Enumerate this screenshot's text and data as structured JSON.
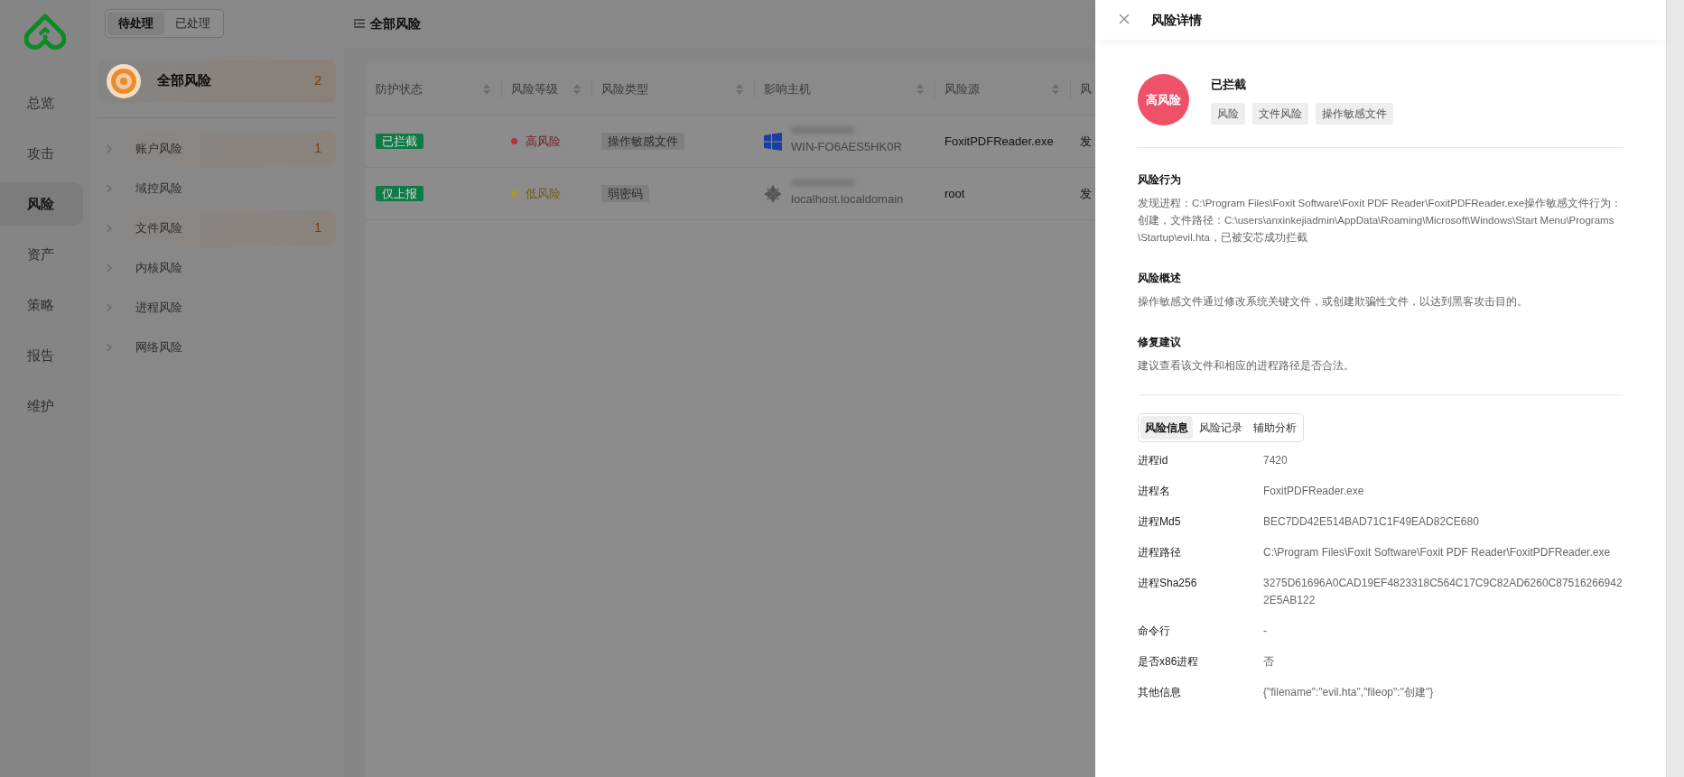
{
  "nav": [
    {
      "label": "总览",
      "selected": false
    },
    {
      "label": "攻击",
      "selected": false
    },
    {
      "label": "风险",
      "selected": true
    },
    {
      "label": "资产",
      "selected": false
    },
    {
      "label": "策略",
      "selected": false
    },
    {
      "label": "报告",
      "selected": false
    },
    {
      "label": "维护",
      "selected": false
    }
  ],
  "status_tabs": [
    {
      "label": "待处理",
      "selected": true
    },
    {
      "label": "已处理",
      "selected": false
    }
  ],
  "all_risks": {
    "label": "全部风险",
    "count": "2",
    "selected": true
  },
  "categories": [
    {
      "label": "账户风险",
      "count": "1"
    },
    {
      "label": "域控风险"
    },
    {
      "label": "文件风险",
      "count": "1"
    },
    {
      "label": "内核风险"
    },
    {
      "label": "进程风险"
    },
    {
      "label": "网络风险"
    }
  ],
  "main": {
    "title": "全部风险"
  },
  "table": {
    "columns": [
      {
        "label": "防护状态",
        "sortable": true
      },
      {
        "label": "风险等级",
        "sortable": true
      },
      {
        "label": "风险类型",
        "sortable": true
      },
      {
        "label": "影响主机",
        "sortable": true
      },
      {
        "label": "风险源",
        "sortable": true
      },
      {
        "label": "风",
        "sortable": false
      }
    ],
    "rows": [
      {
        "protection": "已拦截",
        "level": {
          "text": "高风险",
          "color": "#b8313f"
        },
        "type": "操作敏感文件",
        "host": {
          "kind": "windows",
          "name": "WIN-FO6AES5HK0R"
        },
        "source": "FoxitPDFReader.exe",
        "column_6": "发"
      },
      {
        "protection": "仅上报",
        "level": {
          "text": "低风险",
          "color": "#b0932e"
        },
        "type": "弱密码",
        "host": {
          "kind": "linux",
          "name": "localhost.localdomain"
        },
        "source": "root",
        "column_6": "发"
      }
    ]
  },
  "drawer": {
    "title": "风险详情",
    "level_badge": {
      "text": "高风险",
      "color": "#ef5169"
    },
    "status": "已拦截",
    "tags": [
      "风险",
      "文件风险",
      "操作敏感文件"
    ],
    "sections": [
      {
        "heading": "风险行为",
        "text": "发现进程：C:\\Program Files\\Foxit Software\\Foxit PDF Reader\\FoxitPDFReader.exe操作敏感文件行为：创建，文件路径：C:\\users\\anxinkejiadmin\\AppData\\Roaming\\Microsoft\\Windows\\Start Menu\\Programs\\Startup\\evil.hta，已被安芯成功拦截"
      },
      {
        "heading": "风险概述",
        "text": "操作敏感文件通过修改系统关键文件，或创建欺骗性文件，以达到黑客攻击目的。"
      },
      {
        "heading": "修复建议",
        "text": "建议查看该文件和相应的进程路径是否合法。"
      }
    ],
    "tabs": [
      {
        "label": "风险信息",
        "selected": true
      },
      {
        "label": "风险记录",
        "selected": false
      },
      {
        "label": "辅助分析",
        "selected": false
      }
    ],
    "fields": [
      {
        "label": "进程id",
        "value": "7420"
      },
      {
        "label": "进程名",
        "value": "FoxitPDFReader.exe"
      },
      {
        "label": "进程Md5",
        "value": "BEC7DD42E514BAD71C1F49EAD82CE680"
      },
      {
        "label": "进程路径",
        "value": "C:\\Program Files\\Foxit Software\\Foxit PDF Reader\\FoxitPDFReader.exe"
      },
      {
        "label": "进程Sha256",
        "value": "3275D61696A0CAD19EF4823318C564C17C9C82AD6260C875162669422E5AB122"
      },
      {
        "label": "命令行",
        "value": "-"
      },
      {
        "label": "是否x86进程",
        "value": "否"
      },
      {
        "label": "其他信息",
        "value": "{\"filename\":\"evil.hta\",\"fileop\":\"创建\"}"
      }
    ]
  }
}
